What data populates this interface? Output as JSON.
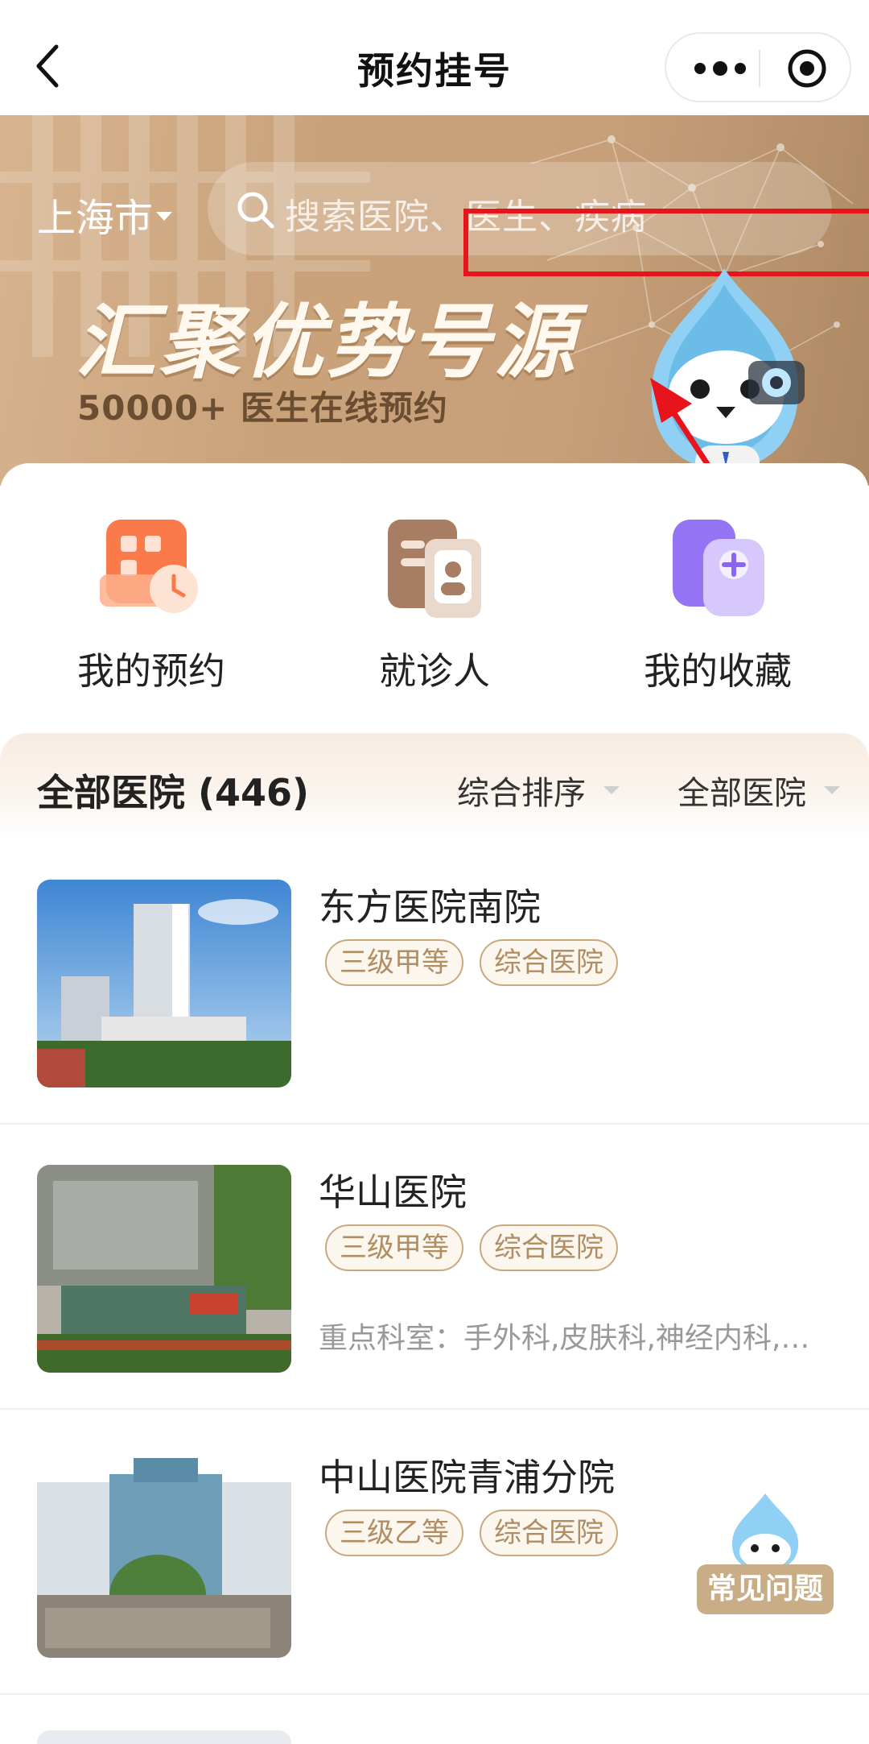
{
  "navbar": {
    "title": "预约挂号",
    "back_icon": "chevron-left-icon",
    "more_icon": "more-dots-icon",
    "close_icon": "target-circle-icon"
  },
  "banner": {
    "city": "上海市",
    "search_placeholder": "搜索医院、医生、疾病",
    "headline": "汇聚优势号源",
    "subline": "50000+ 医生在线预约",
    "colors": {
      "bg": "#c9a27a",
      "highlight_box": "#e8141c",
      "arrow": "#e8141c"
    }
  },
  "quick_entries": [
    {
      "label": "我的预约",
      "icon": "calendar-clock-icon"
    },
    {
      "label": "就诊人",
      "icon": "patient-card-icon"
    },
    {
      "label": "我的收藏",
      "icon": "user-plus-icon"
    }
  ],
  "filter": {
    "title": "全部医院 (446)",
    "sort_label": "综合排序",
    "type_label": "全部医院"
  },
  "hospitals": [
    {
      "name": "东方医院南院",
      "tags": [
        "三级甲等",
        "综合医院"
      ],
      "departments": ""
    },
    {
      "name": "华山医院",
      "tags": [
        "三级甲等",
        "综合医院"
      ],
      "departments": "重点科室：手外科,皮肤科,神经内科,…"
    },
    {
      "name": "中山医院青浦分院",
      "tags": [
        "三级乙等",
        "综合医院"
      ],
      "departments": ""
    }
  ],
  "faq": {
    "label": "常见问题",
    "icon": "mascot-icon"
  }
}
